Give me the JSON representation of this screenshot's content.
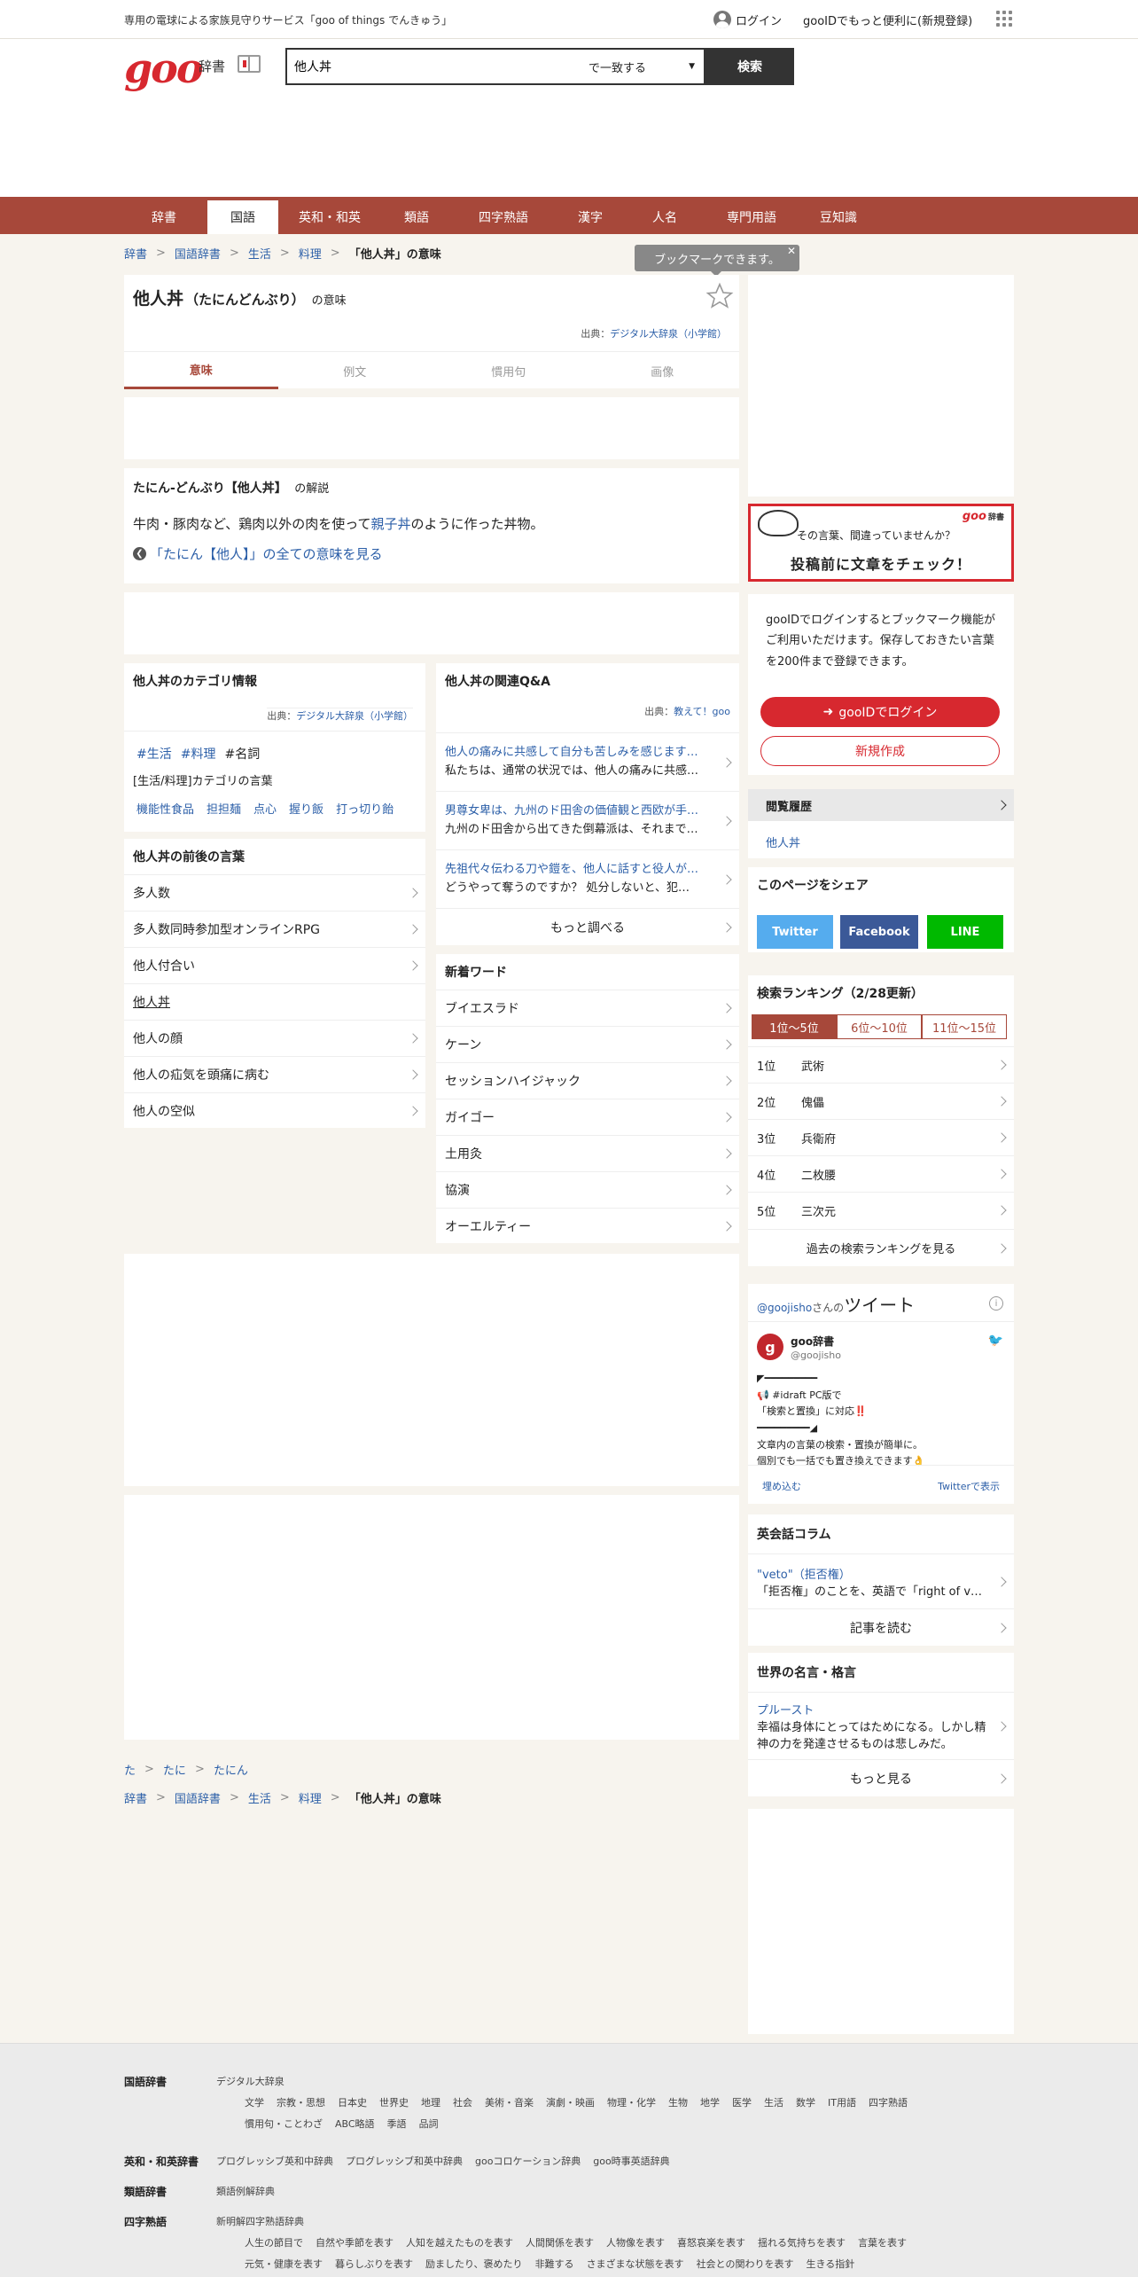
{
  "topbar": {
    "promo": "専用の電球による家族見守りサービス「goo of things でんきゅう」",
    "login": "ログイン",
    "register": "gooIDでもっと便利に(新規登録)"
  },
  "header": {
    "logo": "goo",
    "dict_label": "辞書",
    "search_value": "他人丼",
    "search_mode": "で一致する",
    "search_button": "検索"
  },
  "nav": [
    "辞書",
    "国語",
    "英和・和英",
    "類語",
    "四字熟語",
    "漢字",
    "人名",
    "専門用語",
    "豆知識"
  ],
  "nav_active": "国語",
  "breadcrumb": {
    "items": [
      "辞書",
      "国語辞書",
      "生活",
      "料理"
    ],
    "current": "「他人丼」の意味"
  },
  "tooltip": "ブックマークできます。",
  "entry": {
    "word": "他人丼",
    "reading": "（たにんどんぶり）",
    "suffix": "の意味",
    "source_prefix": "出典：",
    "source": "デジタル大辞泉（小学館）",
    "tabs": [
      "意味",
      "例文",
      "慣用句",
      "画像"
    ],
    "def_title": "たにん-どんぶり【他人丼】",
    "def_title_suffix": "の解説",
    "def_text_before": "牛肉・豚肉など、鶏肉以外の肉を使って",
    "def_link": "親子丼",
    "def_text_after": "のように作った丼物。",
    "all_meanings": "「たにん【他人】」の全ての意味を見る"
  },
  "category": {
    "title_word": "他人丼",
    "title": "のカテゴリ情報",
    "source_prefix": "出典：",
    "source": "デジタル大辞泉（小学館）",
    "tags": [
      "#生活",
      "#料理",
      "#名詞"
    ],
    "cat_line": "[生活/料理]カテゴリの言葉",
    "related": [
      "機能性食品",
      "担担麺",
      "点心",
      "握り飯",
      "打っ切り飴"
    ]
  },
  "neighbors": {
    "title_word": "他人丼",
    "title": "の前後の言葉",
    "items": [
      "多人数",
      "多人数同時参加型オンラインRPG",
      "他人付合い",
      "他人丼",
      "他人の顔",
      "他人の疝気を頭痛に病む",
      "他人の空似"
    ]
  },
  "qa": {
    "title_word": "他人丼",
    "title": "の関連Q&A",
    "source_prefix": "出典：",
    "source": "教えて！goo",
    "items": [
      {
        "q": "他人の痛みに共感して自分も苦しみを感じます…",
        "a": "私たちは、通常の状況では、他人の痛みに共感…"
      },
      {
        "q": "男尊女卑は、九州のド田舎の価値観と西欧が手…",
        "a": "九州のド田舎から出てきた倒幕派は、それまで…"
      },
      {
        "q": "先祖代々伝わる刀や鎧を、他人に話すと役人が…",
        "a": "どうやって奪うのですか？ 処分しないと、犯…"
      }
    ],
    "more": "もっと調べる"
  },
  "newwords": {
    "title": "新着ワード",
    "items": [
      "ブイエスラド",
      "ケーン",
      "セッションハイジャック",
      "ガイゴー",
      "土用灸",
      "協演",
      "オーエルティー"
    ]
  },
  "bottom_crumbs1": [
    "た",
    "たに",
    "たにん"
  ],
  "side": {
    "check_line1": "その言葉、間違っていませんか？",
    "check_line2": "投稿前に文章をチェック！",
    "check_brand": "goo",
    "check_brand2": "辞書",
    "gooid_text": "gooIDでログインするとブックマーク機能がご利用いただけます。保存しておきたい言葉を200件まで登録できます。",
    "login_btn": "gooIDでログイン",
    "new_btn": "新規作成",
    "history_title": "閲覧履歴",
    "history_item": "他人丼",
    "share_title": "このページをシェア",
    "share": [
      "Twitter",
      "Facebook",
      "LINE"
    ],
    "ranking_title": "検索ランキング",
    "ranking_updated": "（2/28更新）",
    "ranking_tabs": [
      "1位～5位",
      "6位～10位",
      "11位～15位"
    ],
    "ranking": [
      {
        "rank": "1位",
        "word": "武術"
      },
      {
        "rank": "2位",
        "word": "傀儡"
      },
      {
        "rank": "3位",
        "word": "兵衛府"
      },
      {
        "rank": "4位",
        "word": "二枚腰"
      },
      {
        "rank": "5位",
        "word": "三次元"
      }
    ],
    "ranking_more": "過去の検索ランキングを見る",
    "tweet_handle": "@goojisho",
    "tweet_san": "さんの",
    "tweet_title": "ツイート",
    "tweet_name": "goo辞書",
    "tweet_user": "@goojisho",
    "tweet_lines": [
      "◤━━━━━━━━━",
      "📢 #idraft PC版で",
      "「検索と置換」に対応‼️",
      "━━━━━━━━━◢",
      "文章内の言葉の検索・置換が簡単に。",
      "個別でも一括でも置き換えできます👌"
    ],
    "tweet_embed": "埋め込む",
    "tweet_view": "Twitterで表示",
    "column_title": "英会話コラム",
    "column_link": "\"veto\"（拒否権）",
    "column_text": "「拒否権」のことを、英語で「right of v…",
    "column_more": "記事を読む",
    "quote_title": "世界の名言・格言",
    "quote_author": "プルースト",
    "quote_text": "幸福は身体にとってはためになる。しかし精神の力を発達させるものは悲しみだ。",
    "quote_more": "もっと見る"
  },
  "footer": {
    "kokugo_label": "国語辞書",
    "kokugo_sub": "デジタル大辞泉",
    "kokugo_items": [
      "文学",
      "宗教・思想",
      "日本史",
      "世界史",
      "地理",
      "社会",
      "美術・音楽",
      "演劇・映画",
      "物理・化学",
      "生物",
      "地学",
      "医学",
      "生活",
      "数学",
      "IT用語",
      "四字熟語"
    ],
    "kokugo_items2": [
      "慣用句・ことわざ",
      "ABC略語",
      "季語",
      "品詞"
    ],
    "eiwa_label": "英和・和英辞書",
    "eiwa_items": [
      "プログレッシブ英和中辞典",
      "プログレッシブ和英中辞典",
      "gooコロケーション辞典",
      "goo時事英語辞典"
    ],
    "ruigo_label": "類語辞書",
    "ruigo_items": [
      "類語例解辞典"
    ],
    "yoji_label": "四字熟語",
    "yoji_sub": "新明解四字熟語辞典",
    "yoji_items": [
      "人生の節目で",
      "自然や季節を表す",
      "人知を越えたものを表す",
      "人間関係を表す",
      "人物像を表す",
      "喜怒哀楽を表す",
      "揺れる気持ちを表す",
      "言葉を表す"
    ],
    "yoji_items2": [
      "元気・健康を表す",
      "暮らしぶりを表す",
      "励ましたり、褒めたり",
      "非難する",
      "さまざまな状態を表す",
      "社会との関わりを表す",
      "生きる指針"
    ]
  },
  "colors": {
    "accent": "#a7483a",
    "brand": "#d7282f",
    "link": "#2c5fa8"
  }
}
